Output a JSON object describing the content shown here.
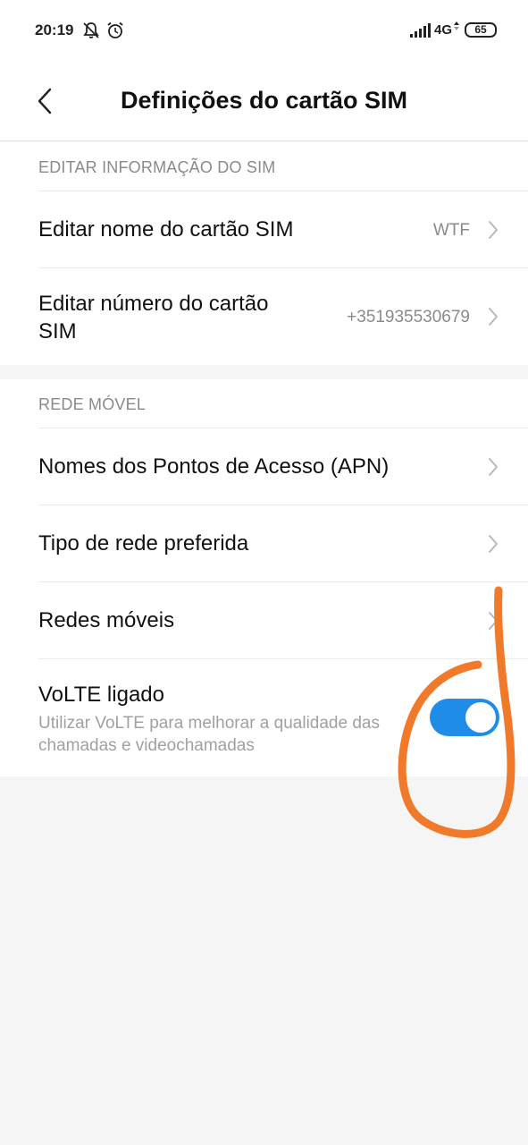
{
  "status_bar": {
    "time": "20:19",
    "network": "4G",
    "battery": "65",
    "icons": [
      "bell-off-icon",
      "alarm-icon",
      "signal-icon",
      "battery-icon"
    ]
  },
  "header": {
    "back_icon": "chevron-left-icon",
    "title": "Definições do cartão SIM"
  },
  "sections": {
    "sim_info": {
      "label": "EDITAR INFORMAÇÃO DO SIM",
      "items": [
        {
          "title": "Editar nome do cartão SIM",
          "value": "WTF"
        },
        {
          "title": "Editar número do cartão\nSIM",
          "value": "+351935530679"
        }
      ]
    },
    "mobile_network": {
      "label": "REDE MÓVEL",
      "items": [
        {
          "title": "Nomes dos Pontos de Acesso (APN)"
        },
        {
          "title": "Tipo de rede preferida"
        },
        {
          "title": "Redes móveis"
        }
      ],
      "volte": {
        "title": "VoLTE ligado",
        "subtitle": "Utilizar VoLTE para melhorar a qualidade das chamadas e videochamadas",
        "enabled": true
      }
    }
  },
  "colors": {
    "toggle_on": "#1f8de8",
    "annotation_stroke": "#f07a2a"
  }
}
